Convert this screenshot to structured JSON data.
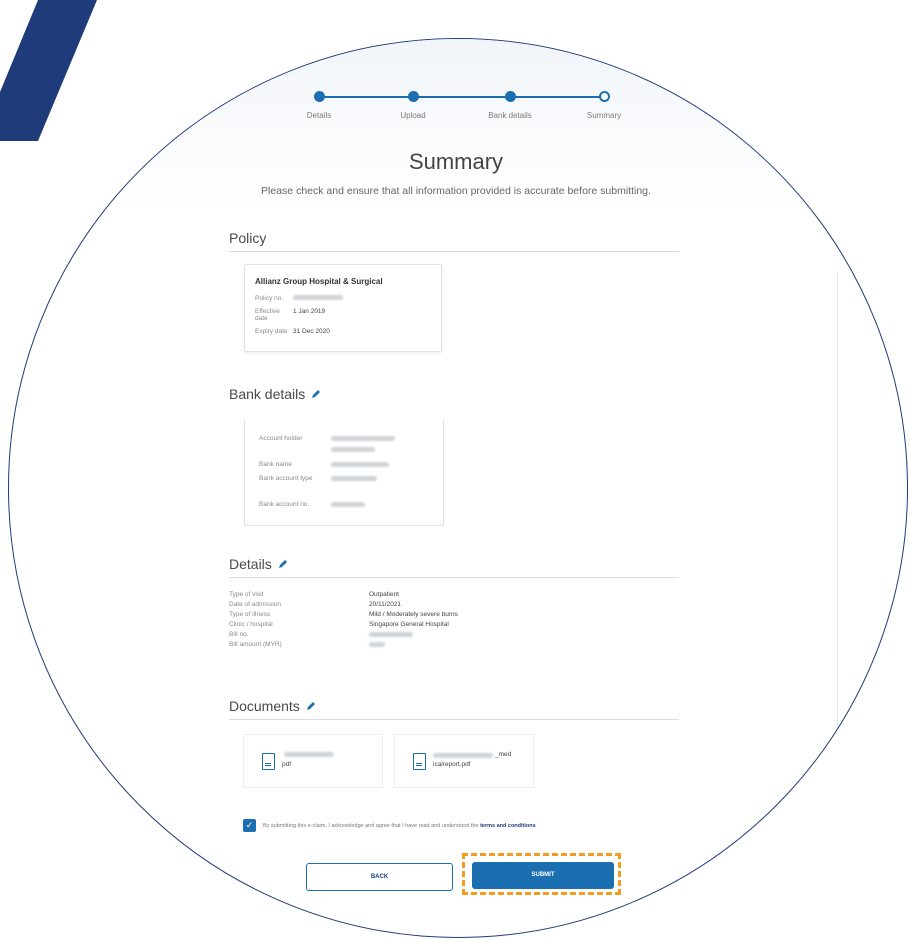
{
  "steps": [
    "Details",
    "Upload",
    "Bank details",
    "Summary"
  ],
  "title": "Summary",
  "subtitle": "Please check and ensure that all information provided is accurate before submitting.",
  "policy": {
    "section_title": "Policy",
    "card_title": "Allianz Group Hospital & Surgical",
    "labels": [
      "Policy no.",
      "Effective date",
      "Expiry date"
    ],
    "values": [
      "",
      "1 Jan 2019",
      "31 Dec 2020"
    ]
  },
  "bank": {
    "section_title": "Bank details",
    "labels": [
      "Account holder",
      "Bank name",
      "Bank account type",
      "Bank account no."
    ]
  },
  "details": {
    "section_title": "Details",
    "labels": [
      "Type of visit",
      "Date of admission",
      "Type of illness",
      "Clinic / hospital",
      "Bill no.",
      "Bill amount (MYR)"
    ],
    "values": [
      "Outpatient",
      "20/11/2021",
      "Mild / Moderately severe burns",
      "Singapore General Hospital",
      "",
      ""
    ]
  },
  "documents": {
    "section_title": "Documents",
    "files": [
      {
        "line1": "",
        "line2": "pdf"
      },
      {
        "line1": "_med",
        "line2": "icalreport.pdf"
      }
    ]
  },
  "consent": {
    "text": "By submitting this e-claim, I acknowledge and agree that I have read and understood the ",
    "link": "terms and conditions"
  },
  "buttons": {
    "back": "BACK",
    "submit": "SUBMIT"
  },
  "colors": {
    "primary": "#1b6fb0",
    "brand_dark": "#1f3b7a",
    "highlight": "#f39c1e"
  }
}
